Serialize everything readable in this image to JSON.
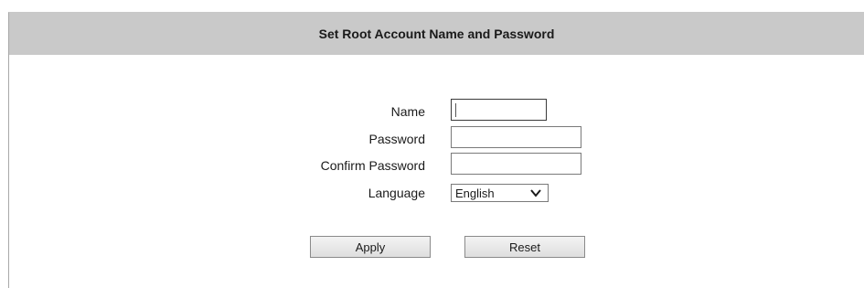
{
  "header": {
    "title": "Set Root Account Name and Password"
  },
  "form": {
    "name_label": "Name",
    "name_value": "",
    "password_label": "Password",
    "password_value": "",
    "confirm_label": "Confirm Password",
    "confirm_value": "",
    "language_label": "Language",
    "language_selected": "English"
  },
  "buttons": {
    "apply": "Apply",
    "reset": "Reset"
  },
  "icons": {
    "dropdown": "chevron-down-icon"
  }
}
